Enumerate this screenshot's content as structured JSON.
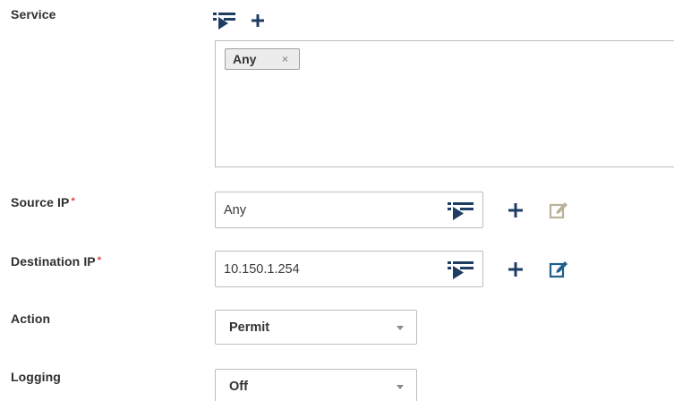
{
  "service": {
    "label": "Service",
    "chips": [
      {
        "label": "Any",
        "remove_glyph": "×"
      }
    ]
  },
  "source_ip": {
    "label": "Source IP",
    "required_mark": "*",
    "value": "Any"
  },
  "destination_ip": {
    "label": "Destination IP",
    "required_mark": "*",
    "value": "10.150.1.254"
  },
  "action": {
    "label": "Action",
    "selected": "Permit"
  },
  "logging": {
    "label": "Logging",
    "selected": "Off"
  },
  "icons": {
    "filter": "filter-list-icon",
    "add": "plus-icon",
    "edit": "edit-icon"
  },
  "colors": {
    "icon_blue": "#1f3d63",
    "edit_disabled": "#b8b29a",
    "edit_active": "#1f5f8b",
    "required": "#e0413a"
  }
}
